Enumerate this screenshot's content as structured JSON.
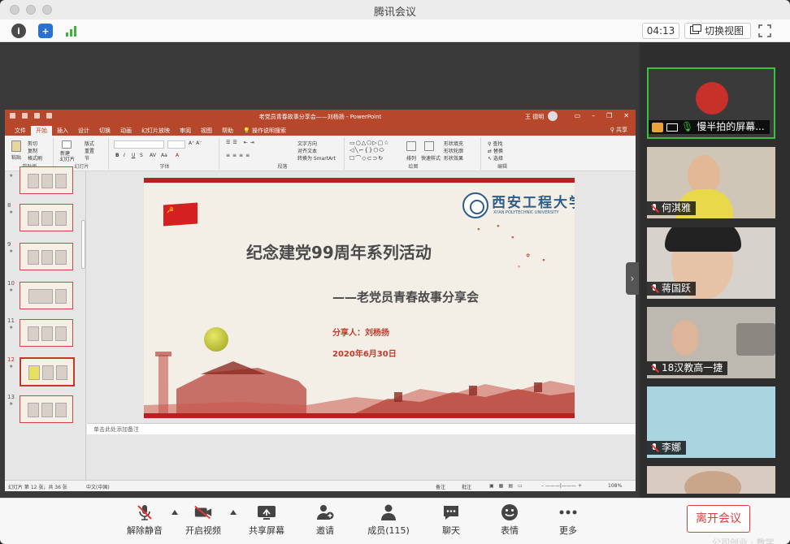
{
  "window": {
    "title": "腾讯会议"
  },
  "infobar": {
    "timer": "04:13",
    "switch_view": "切换视图"
  },
  "ppt": {
    "title": "老党员青春故事分享会——刘杨扬 - PowerPoint",
    "user": "王 德明",
    "tabs": [
      "文件",
      "开始",
      "插入",
      "设计",
      "切换",
      "动画",
      "幻灯片放映",
      "审阅",
      "视图",
      "帮助"
    ],
    "active_tab": "开始",
    "search": "操作说明搜索",
    "share": "共享",
    "ribbon": {
      "paste": "粘贴",
      "cut": "剪切",
      "copy": "复制",
      "format_painter": "格式刷",
      "clipboard": "剪贴板",
      "new_slide": "新建\n幻灯片",
      "layout": "版式",
      "reset": "重置",
      "section": "节",
      "slides": "幻灯片",
      "font": "字体",
      "text_direction": "文字方向",
      "align_text": "对齐文本",
      "smartart": "转换为 SmartArt",
      "paragraph": "段落",
      "arrange": "排列",
      "quick_styles": "快速样式",
      "shape_fill": "形状填充",
      "shape_outline": "形状轮廓",
      "shape_effects": "形状效果",
      "drawing": "绘图",
      "find": "查找",
      "replace": "替换",
      "select": "选择",
      "editing": "编辑"
    },
    "thumbnails": [
      {
        "num": "",
        "star": "★"
      },
      {
        "num": "8",
        "star": "★"
      },
      {
        "num": "9",
        "star": "★"
      },
      {
        "num": "10",
        "star": "★"
      },
      {
        "num": "11",
        "star": "★"
      },
      {
        "num": "12",
        "star": "★"
      },
      {
        "num": "13",
        "star": "★"
      }
    ],
    "selected_thumb": "12",
    "slide": {
      "logo_cn": "西安工程大学",
      "logo_en": "XI'AN POLYTECHNIC UNIVERSITY",
      "title": "纪念建党99周年系列活动",
      "subtitle": "——老党员青春故事分享会",
      "presenter": "分享人：刘杨扬",
      "date": "2020年6月30日"
    },
    "notes_placeholder": "单击此处添加备注",
    "status": {
      "slide_info": "幻灯片 第 12 张，共 36 张",
      "language": "中文(中国)",
      "notes": "备注",
      "comments": "批注",
      "zoom": "108%"
    }
  },
  "participants": [
    {
      "name": "慢半拍的屏幕...",
      "active": true,
      "muted": false
    },
    {
      "name": "何淇雅",
      "active": false,
      "muted": true
    },
    {
      "name": "蒋国跃",
      "active": false,
      "muted": true
    },
    {
      "name": "18汉教高一捷",
      "active": false,
      "muted": true
    },
    {
      "name": "李娜",
      "active": false,
      "muted": true
    },
    {
      "name": "",
      "active": false,
      "muted": false
    }
  ],
  "toolbar": {
    "unmute": "解除静音",
    "start_video": "开启视频",
    "share_screen": "共享屏幕",
    "invite": "邀请",
    "members": "成员(115)",
    "chat": "聊天",
    "reactions": "表情",
    "more": "更多",
    "leave": "离开会议"
  },
  "corner_text": "公司创业 · 教学"
}
